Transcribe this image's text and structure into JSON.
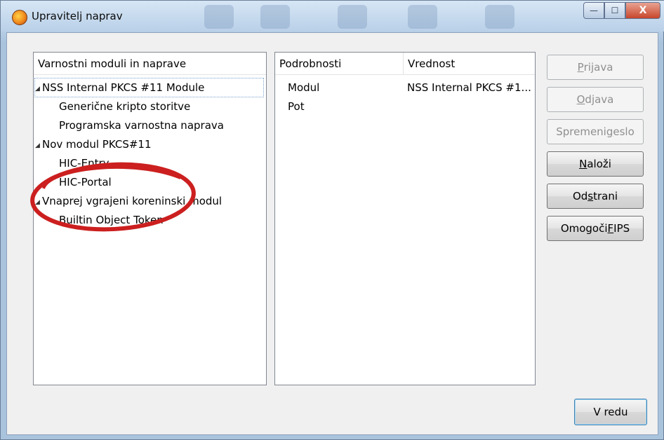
{
  "window": {
    "title": "Upravitelj naprav",
    "minimize_glyph": "—",
    "maximize_glyph": "☐",
    "close_glyph": "X"
  },
  "modules_panel": {
    "header": "Varnostni moduli in naprave",
    "tree": [
      {
        "label": "NSS Internal PKCS #11 Module",
        "level": 0,
        "expanded": true,
        "selected": true
      },
      {
        "label": "Generične kripto storitve",
        "level": 1
      },
      {
        "label": "Programska varnostna naprava",
        "level": 1
      },
      {
        "label": "Nov modul PKCS#11",
        "level": 0,
        "expanded": true
      },
      {
        "label": "HIC-Entry",
        "level": 1
      },
      {
        "label": "HIC-Portal",
        "level": 1
      },
      {
        "label": "Vnaprej vgrajeni koreninski modul",
        "level": 0,
        "expanded": true
      },
      {
        "label": "Builtin Object Token",
        "level": 1
      }
    ]
  },
  "details_panel": {
    "col_details": "Podrobnosti",
    "col_value": "Vrednost",
    "rows": [
      {
        "key": "Modul",
        "value": "NSS Internal PKCS #1..."
      },
      {
        "key": "Pot",
        "value": ""
      }
    ]
  },
  "buttons": {
    "login": {
      "pre": "",
      "key": "P",
      "post": "rijava",
      "enabled": false
    },
    "logout": {
      "pre": "",
      "key": "O",
      "post": "djava",
      "enabled": false
    },
    "change_password": {
      "pre": "Spremeni ",
      "key": "g",
      "post": "eslo",
      "enabled": false
    },
    "load": {
      "pre": "",
      "key": "N",
      "post": "aloži",
      "enabled": true
    },
    "remove": {
      "pre": "Od",
      "key": "s",
      "post": "trani",
      "enabled": true
    },
    "enable_fips": {
      "pre": "Omogoči ",
      "key": "F",
      "post": "IPS",
      "enabled": true
    },
    "ok": "V redu"
  },
  "annotation_color": "#cc1f1f"
}
